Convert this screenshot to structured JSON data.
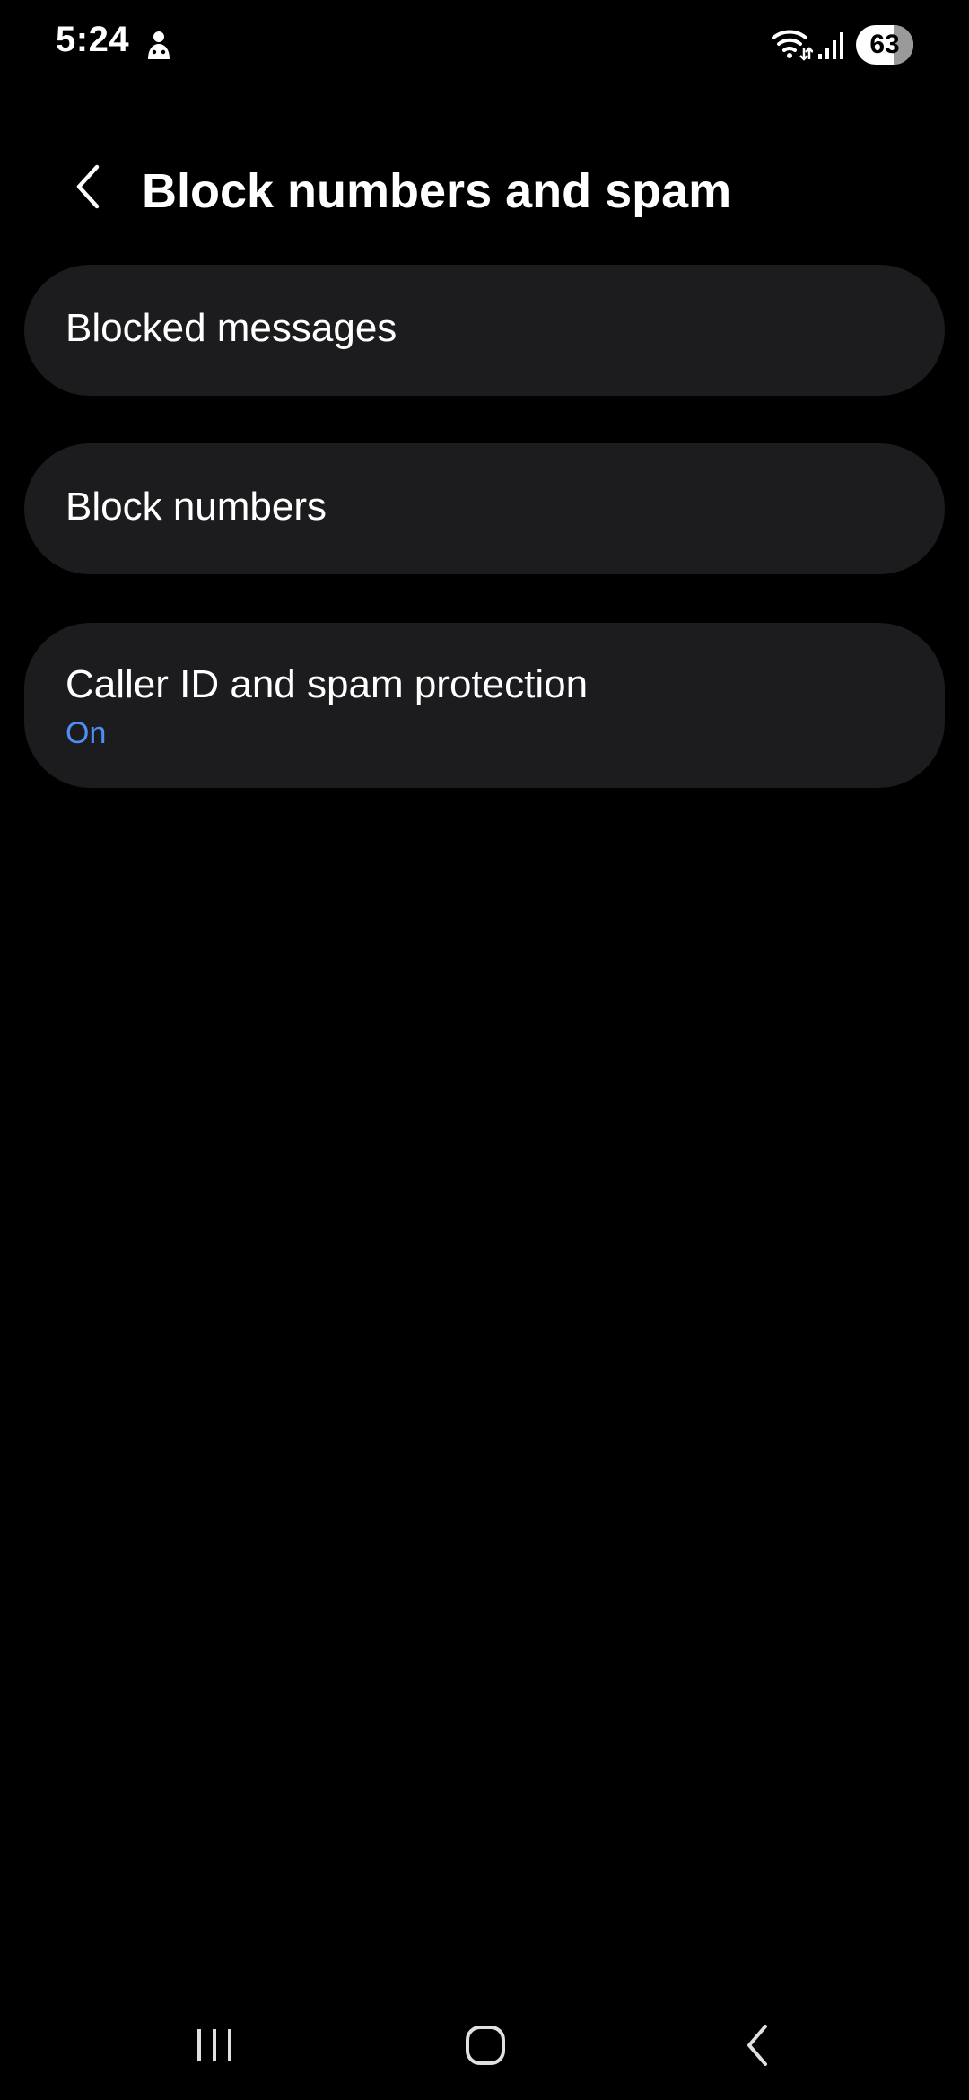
{
  "status_bar": {
    "time": "5:24",
    "battery_level": "63",
    "battery_percent": 63,
    "icons": [
      "notification-icon",
      "wifi-icon",
      "signal-icon",
      "battery-icon"
    ]
  },
  "header": {
    "title": "Block numbers and spam",
    "back_icon": "chevron-left-icon"
  },
  "items": [
    {
      "title": "Blocked messages"
    },
    {
      "title": "Block numbers"
    },
    {
      "title": "Caller ID and spam protection",
      "subtitle": "On"
    }
  ],
  "nav_bar": {
    "icons": [
      "recents-icon",
      "home-icon",
      "back-icon"
    ]
  },
  "colors": {
    "background": "#000000",
    "card": "#1c1c1e",
    "accent": "#4f8ef5",
    "text": "#ffffff"
  }
}
